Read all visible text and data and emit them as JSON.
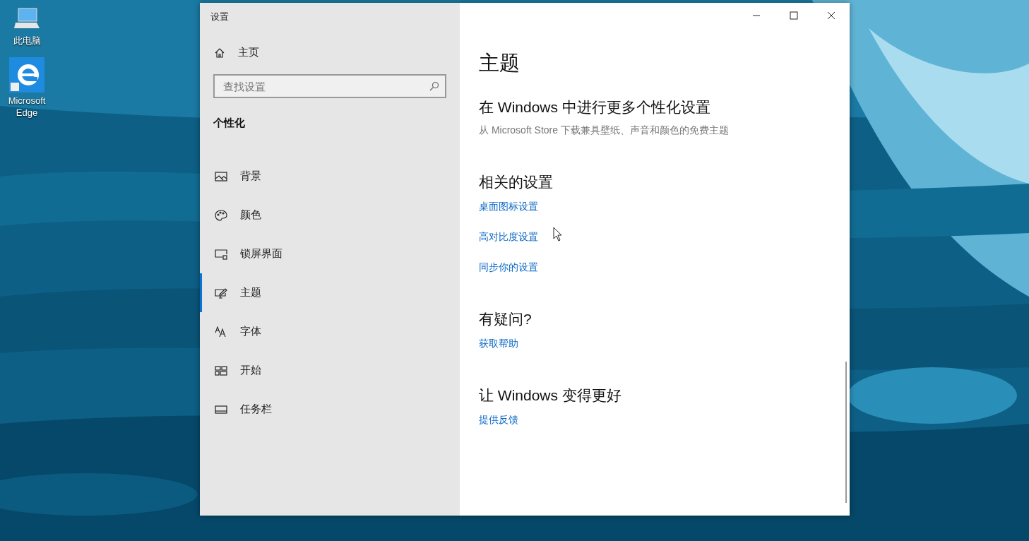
{
  "desktop_icons": [
    {
      "label": "此电脑"
    },
    {
      "label": "Microsoft Edge"
    }
  ],
  "window": {
    "title": "设置"
  },
  "sidebar": {
    "home": "主页",
    "search": {
      "placeholder": "查找设置"
    },
    "section": "个性化",
    "items": [
      {
        "label": "背景",
        "selected": false
      },
      {
        "label": "颜色",
        "selected": false
      },
      {
        "label": "锁屏界面",
        "selected": false
      },
      {
        "label": "主题",
        "selected": true
      },
      {
        "label": "字体",
        "selected": false
      },
      {
        "label": "开始",
        "selected": false
      },
      {
        "label": "任务栏",
        "selected": false
      }
    ]
  },
  "content": {
    "title": "主题",
    "sections": [
      {
        "heading": "在 Windows 中进行更多个性化设置",
        "description": "从 Microsoft Store 下载兼具壁纸、声音和颜色的免费主题"
      },
      {
        "heading": "相关的设置",
        "links": [
          "桌面图标设置",
          "高对比度设置",
          "同步你的设置"
        ]
      },
      {
        "heading": "有疑问?",
        "links": [
          "获取帮助"
        ]
      },
      {
        "heading": "让 Windows 变得更好",
        "links": [
          "提供反馈"
        ]
      }
    ]
  }
}
